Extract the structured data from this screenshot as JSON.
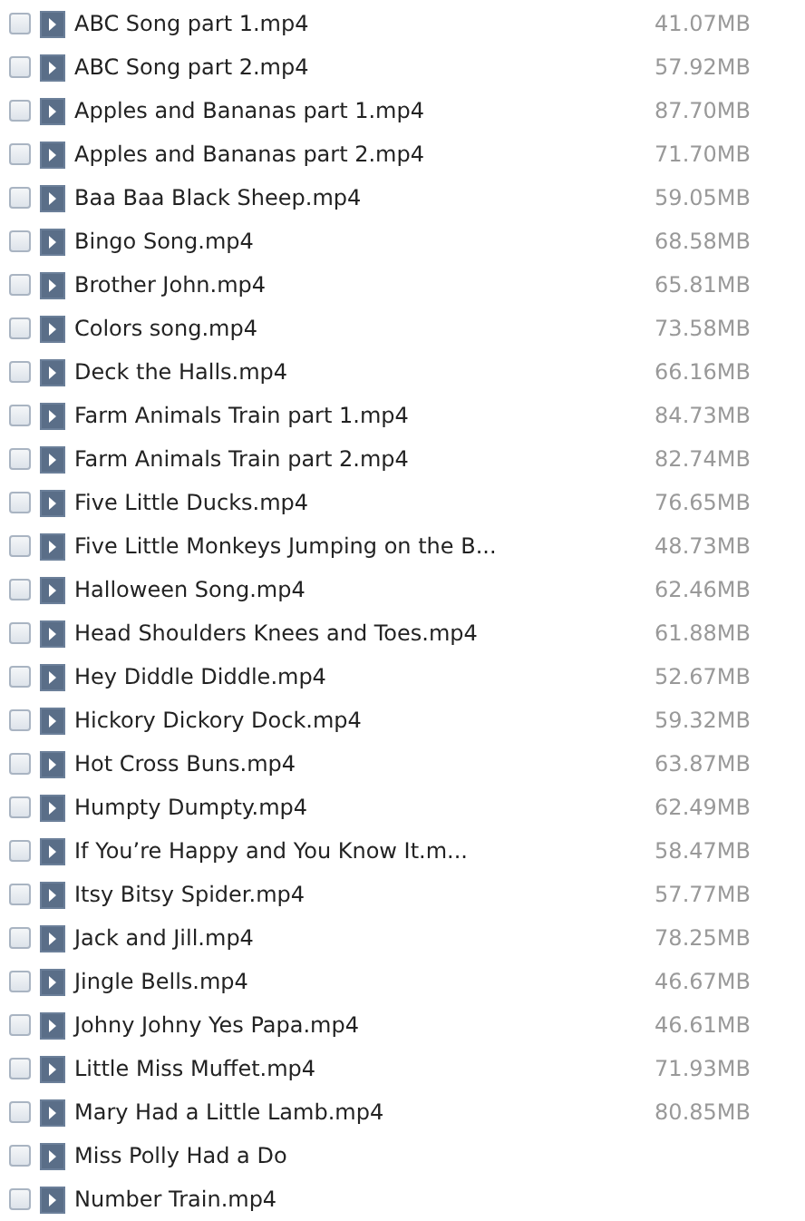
{
  "files": [
    {
      "name": "ABC Song part 1.mp4",
      "size": "41.07MB",
      "checked": false
    },
    {
      "name": "ABC Song part 2.mp4",
      "size": "57.92MB",
      "checked": false
    },
    {
      "name": "Apples and Bananas part 1.mp4",
      "size": "87.70MB",
      "checked": false
    },
    {
      "name": "Apples and Bananas part 2.mp4",
      "size": "71.70MB",
      "checked": false
    },
    {
      "name": "Baa Baa Black Sheep.mp4",
      "size": "59.05MB",
      "checked": false
    },
    {
      "name": "Bingo Song.mp4",
      "size": "68.58MB",
      "checked": false
    },
    {
      "name": "Brother John.mp4",
      "size": "65.81MB",
      "checked": false
    },
    {
      "name": "Colors song.mp4",
      "size": "73.58MB",
      "checked": false
    },
    {
      "name": "Deck the Halls.mp4",
      "size": "66.16MB",
      "checked": false
    },
    {
      "name": "Farm Animals Train part 1.mp4",
      "size": "84.73MB",
      "checked": false
    },
    {
      "name": "Farm Animals Train part 2.mp4",
      "size": "82.74MB",
      "checked": false
    },
    {
      "name": "Five Little Ducks.mp4",
      "size": "76.65MB",
      "checked": false
    },
    {
      "name": "Five Little Monkeys Jumping on the B...",
      "size": "48.73MB",
      "checked": false
    },
    {
      "name": "Halloween Song.mp4",
      "size": "62.46MB",
      "checked": false
    },
    {
      "name": "Head Shoulders Knees and Toes.mp4",
      "size": "61.88MB",
      "checked": false
    },
    {
      "name": "Hey Diddle Diddle.mp4",
      "size": "52.67MB",
      "checked": false
    },
    {
      "name": "Hickory Dickory Dock.mp4",
      "size": "59.32MB",
      "checked": false
    },
    {
      "name": "Hot Cross Buns.mp4",
      "size": "63.87MB",
      "checked": false
    },
    {
      "name": "Humpty Dumpty.mp4",
      "size": "62.49MB",
      "checked": false
    },
    {
      "name": "If You’re Happy and You Know It.m...",
      "size": "58.47MB",
      "checked": false
    },
    {
      "name": "Itsy Bitsy Spider.mp4",
      "size": "57.77MB",
      "checked": false
    },
    {
      "name": "Jack and Jill.mp4",
      "size": "78.25MB",
      "checked": false
    },
    {
      "name": "Jingle Bells.mp4",
      "size": "46.67MB",
      "checked": false
    },
    {
      "name": "Johny Johny Yes Papa.mp4",
      "size": "46.61MB",
      "checked": false
    },
    {
      "name": "Little Miss Muffet.mp4",
      "size": "71.93MB",
      "checked": false
    },
    {
      "name": "Mary Had a Little Lamb.mp4",
      "size": "80.85MB",
      "checked": false
    },
    {
      "name": "Miss Polly Had a Do",
      "checked": false
    },
    {
      "name": "Number Train.mp4",
      "checked": false
    }
  ]
}
